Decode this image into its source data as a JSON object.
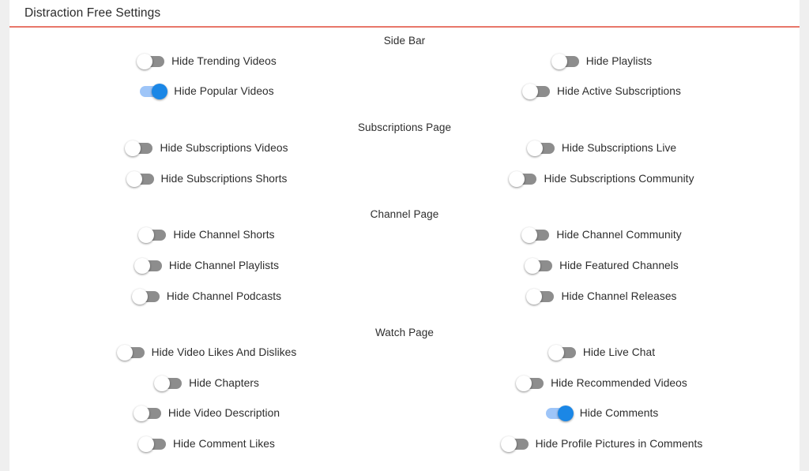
{
  "header": {
    "title": "Distraction Free Settings",
    "rule_color": "#e8776a"
  },
  "colors": {
    "toggle_on_track": "#9ec5f8",
    "toggle_on_thumb": "#1b87e6",
    "toggle_off_track": "#8d8d8d",
    "toggle_off_thumb": "#ffffff",
    "page_background": "#ffffff",
    "window_background": "#efefef",
    "text": "#2d2d2d"
  },
  "sections": [
    {
      "id": "sidebar",
      "title": "Side Bar",
      "rows": [
        [
          {
            "label": "Hide Trending Videos",
            "on": false
          },
          {
            "label": "Hide Playlists",
            "on": false
          }
        ],
        [
          {
            "label": "Hide Popular Videos",
            "on": true
          },
          {
            "label": "Hide Active Subscriptions",
            "on": false
          }
        ]
      ]
    },
    {
      "id": "subscriptions",
      "title": "Subscriptions Page",
      "rows": [
        [
          {
            "label": "Hide Subscriptions Videos",
            "on": false
          },
          {
            "label": "Hide Subscriptions Live",
            "on": false
          }
        ],
        [
          {
            "label": "Hide Subscriptions Shorts",
            "on": false
          },
          {
            "label": "Hide Subscriptions Community",
            "on": false
          }
        ]
      ]
    },
    {
      "id": "channel",
      "title": "Channel Page",
      "rows": [
        [
          {
            "label": "Hide Channel Shorts",
            "on": false
          },
          {
            "label": "Hide Channel Community",
            "on": false
          }
        ],
        [
          {
            "label": "Hide Channel Playlists",
            "on": false
          },
          {
            "label": "Hide Featured Channels",
            "on": false
          }
        ],
        [
          {
            "label": "Hide Channel Podcasts",
            "on": false
          },
          {
            "label": "Hide Channel Releases",
            "on": false
          }
        ]
      ]
    },
    {
      "id": "watch",
      "title": "Watch Page",
      "rows": [
        [
          {
            "label": "Hide Video Likes And Dislikes",
            "on": false
          },
          {
            "label": "Hide Live Chat",
            "on": false
          }
        ],
        [
          {
            "label": "Hide Chapters",
            "on": false
          },
          {
            "label": "Hide Recommended Videos",
            "on": false
          }
        ],
        [
          {
            "label": "Hide Video Description",
            "on": false
          },
          {
            "label": "Hide Comments",
            "on": true
          }
        ],
        [
          {
            "label": "Hide Comment Likes",
            "on": false
          },
          {
            "label": "Hide Profile Pictures in Comments",
            "on": false
          }
        ]
      ]
    }
  ]
}
